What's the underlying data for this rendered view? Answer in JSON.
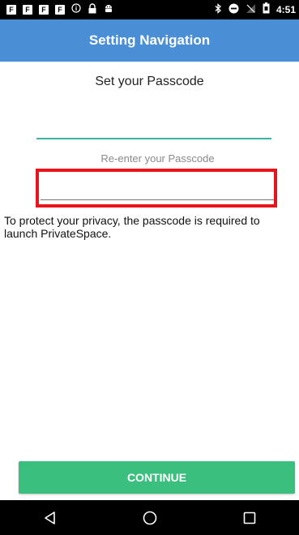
{
  "status_bar": {
    "time": "4:51",
    "left_icons": [
      "notification-f-icon",
      "notification-f-icon",
      "notification-f-icon",
      "notification-f-icon",
      "info-circle-icon",
      "lock-icon",
      "android-icon"
    ],
    "right_icons": [
      "bluetooth-icon",
      "do-not-disturb-icon",
      "no-signal-icon",
      "battery-icon"
    ],
    "notif_letter": "F"
  },
  "app_bar": {
    "title": "Setting Navigation",
    "color": "#4a8fd6"
  },
  "form": {
    "set_title": "Set your Passcode",
    "passcode_value": "",
    "reenter_label": "Re-enter your Passcode",
    "reenter_value": "",
    "privacy_text": "To protect your privacy, the passcode is required to launch PrivateSpace.",
    "accent_color": "#3ab5a5",
    "highlight_color": "#e8141c"
  },
  "continue_button": {
    "label": "CONTINUE",
    "color": "#3bbf7e"
  },
  "nav_bar": {
    "items": [
      "back-icon",
      "home-icon",
      "recents-icon"
    ]
  }
}
